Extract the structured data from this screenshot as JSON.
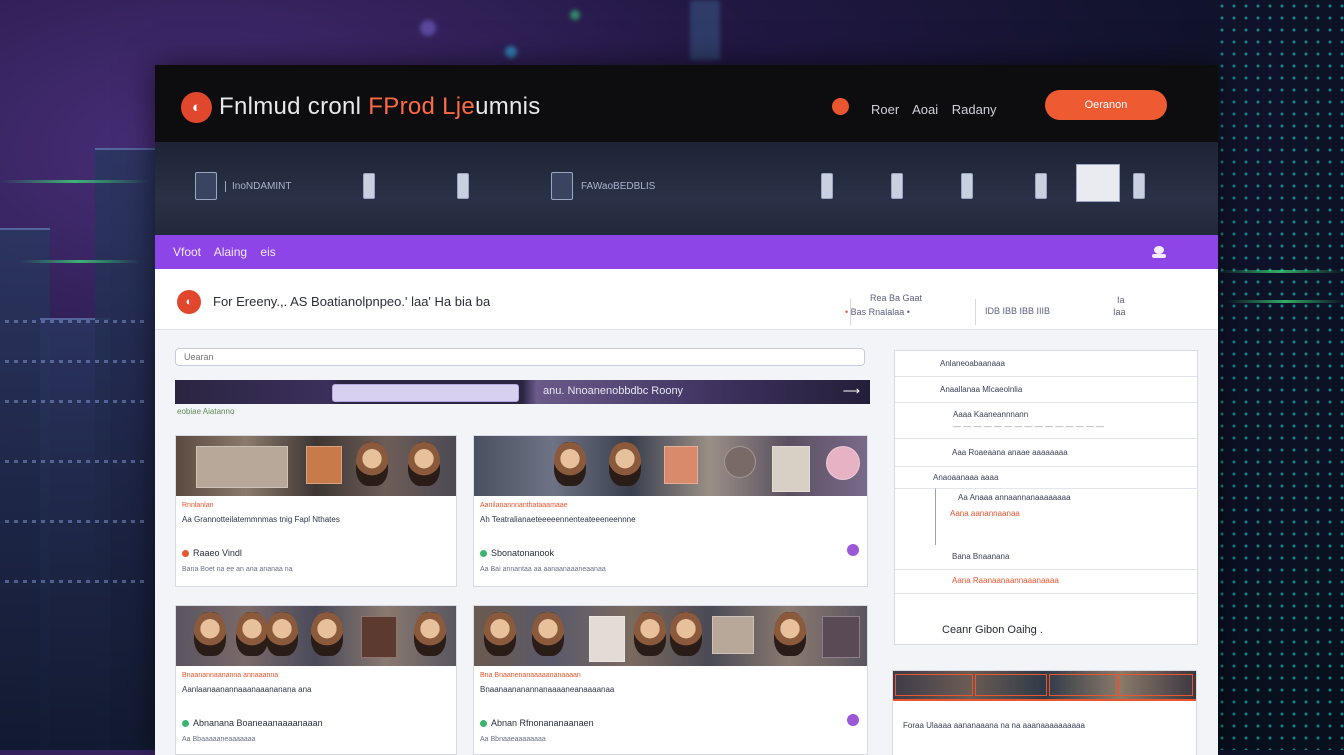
{
  "app": {
    "brand": "Fnlmud cronl",
    "brand_accent": "FProd Lje",
    "brand_tail": "umnis"
  },
  "topnav": {
    "links": [
      "Roer",
      "Aoai",
      "Radany"
    ],
    "cta_label": "Oeranon"
  },
  "banner": {
    "item1_label": "InoNDAMINT",
    "item2_label": "FAWaoBEDBLIS"
  },
  "breadcrumb": [
    "Vfoot",
    "Alaing",
    "eis"
  ],
  "header": {
    "title": "For Ereeny.,. AS Boatianolpnpeo.' laa' Ha bia ba",
    "meta1_top": "Rea Ba Gaat",
    "meta1_bot": "Bas Rnalalaa",
    "meta2": "IDB IBB IBB IIIB",
    "meta3_top": "Ia",
    "meta3_bot": "Iaa"
  },
  "search": {
    "placeholder": "Uearan"
  },
  "featured": {
    "title": "anu. Nnoanenobbdbc Roony",
    "sub": "eobiae Aiatanno"
  },
  "cards": [
    {
      "t1": "Rnnlanlan",
      "t2": "Aa Grannotteilatemmnmas tnig Fapl Nthates",
      "t3": "Raaeo Vindl",
      "t4": "Bana Boet na ee an ana ananaa na"
    },
    {
      "t1": "Aanilanannnanthataaamaae",
      "t2": "Ah Teatralianaeteeeeennenteateeeneennne",
      "t3": "Sbonatonanook",
      "t4": "Aa Bai annantaa aa aanaanaaaneaanaa"
    },
    {
      "t1": "Bnaanannaananna annaaanna",
      "t2": "Aanlaanaanannaaanaaananana ana",
      "t3": "Abnanana Boaneaanaaaanaaan",
      "t4": "Aa Bbaaaaaneaaaaaaa"
    },
    {
      "t1": "Bna Bnaanenanaaaaananaaaan",
      "t2": "Bnaanaananannanaaaaneanaaaanaa",
      "t3": "Abnan Rfnonananaanaen",
      "t4": "Aa Bbnaaeaaaaaaaa"
    }
  ],
  "panel": {
    "row1": "Anlaneoabaanaaa",
    "row2": "Anaallanaa Mlcaeolnlia",
    "row3": "Aaaa Kaaneannnann",
    "row4": "Aaa Roaeaana anaae aaaaaaaa",
    "row5": "Anaoaanaaa aaaa",
    "row6": "Aa Anaaa annaannanaaaaaaaa",
    "row7": "Aana aanannaanaa",
    "row8": "Bana Bnaanana",
    "row9": "Aana Raanaanaannaaanaaaa",
    "footer": "Ceanr Gibon Oaihg ."
  },
  "panel2": {
    "text": "Foraa Ulaaaa aananaaana na na aaanaaaaaaaaaa"
  },
  "colors": {
    "accent": "#ee5a32",
    "purple": "#8d45e8",
    "topbar": "#0d0d10"
  }
}
